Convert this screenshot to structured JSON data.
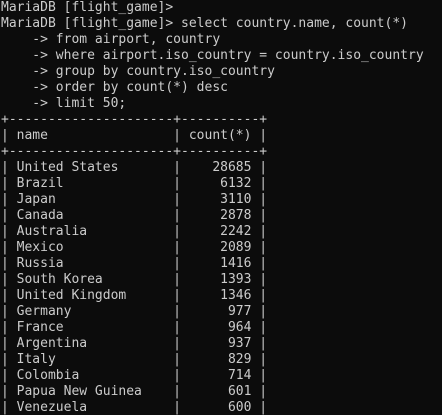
{
  "terminal": {
    "prompt_line": "MariaDB [flight_game]>",
    "command_lines": [
      "MariaDB [flight_game]> select country.name, count(*)",
      "    -> from airport, country",
      "    -> where airport.iso_country = country.iso_country",
      "    -> group by country.iso_country",
      "    -> order by count(*) desc",
      "    -> limit 50;"
    ],
    "table": {
      "border_line": "+---------------------+----------+",
      "header_line": "| name                | count(*) |",
      "rows": [
        "| United States       |    28685 |",
        "| Brazil              |     6132 |",
        "| Japan               |     3110 |",
        "| Canada              |     2878 |",
        "| Australia           |     2242 |",
        "| Mexico              |     2089 |",
        "| Russia              |     1416 |",
        "| South Korea         |     1393 |",
        "| United Kingdom      |     1346 |",
        "| Germany             |      977 |",
        "| France              |      964 |",
        "| Argentina           |      937 |",
        "| Italy               |      829 |",
        "| Colombia            |      714 |",
        "| Papua New Guinea    |      601 |",
        "| Venezuela           |      600 |"
      ]
    }
  }
}
